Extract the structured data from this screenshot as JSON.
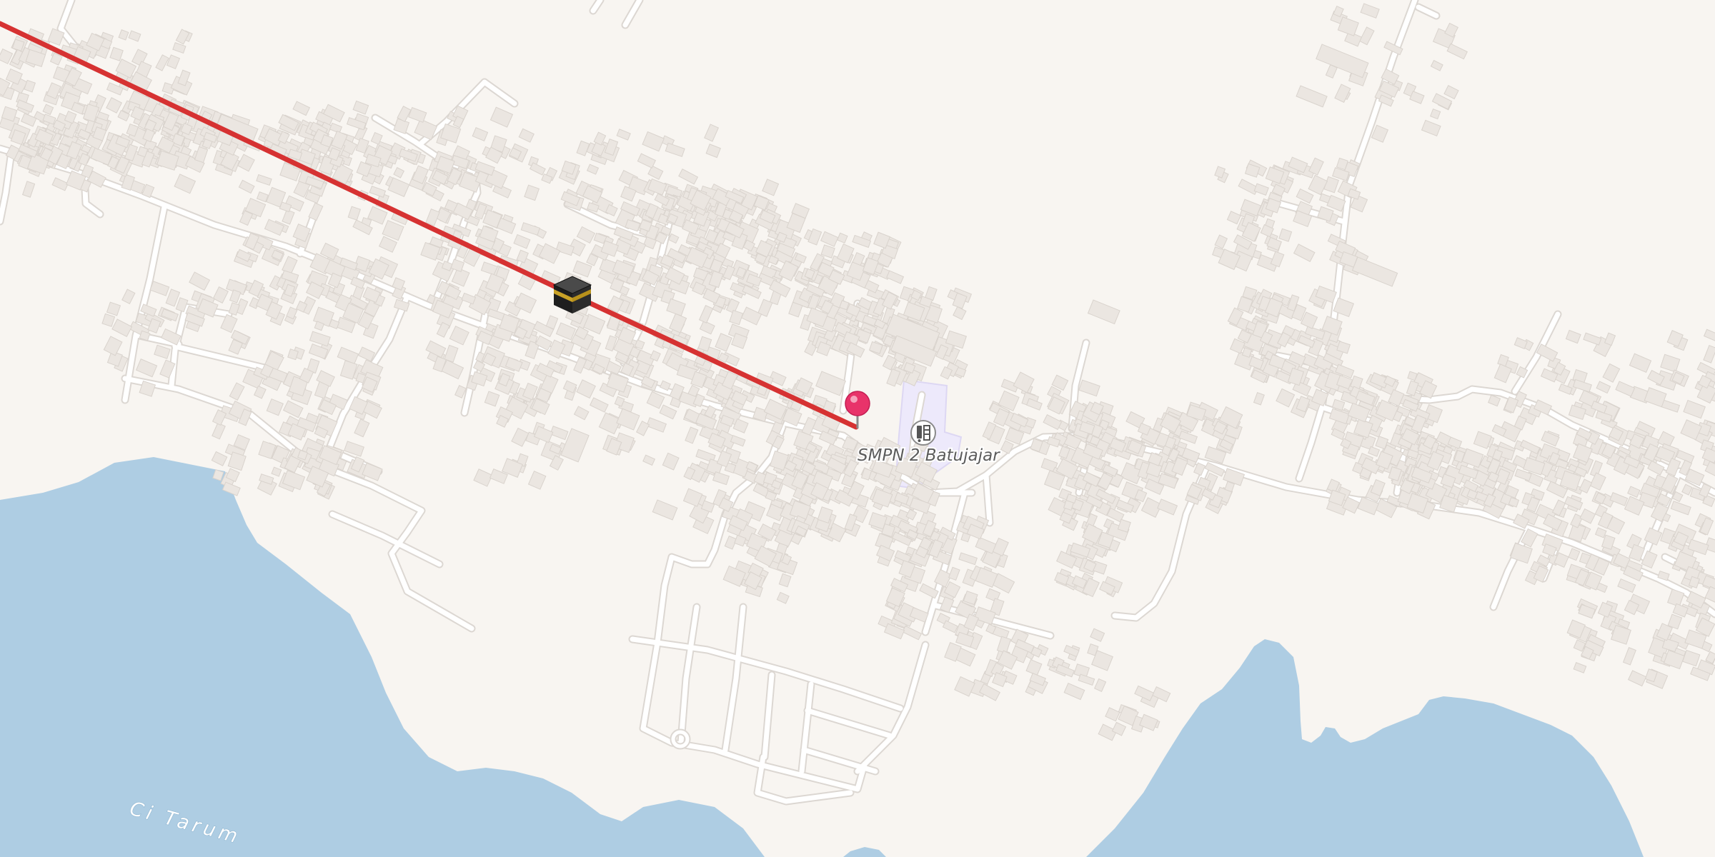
{
  "map": {
    "labels": {
      "school": "SMPN 2 Batujajar",
      "river": "Ci Tarum"
    },
    "icons": {
      "school_poi": "school-icon",
      "marker": "map-pin-icon",
      "destination": "kaaba-icon"
    },
    "colors": {
      "land": "#f8f5f1",
      "water": "#aecde3",
      "road": "#ffffff",
      "building": "#ebe6e1",
      "route_line": "#d63232",
      "pin": "#e8336a",
      "school_area": "#ede9fb"
    }
  }
}
